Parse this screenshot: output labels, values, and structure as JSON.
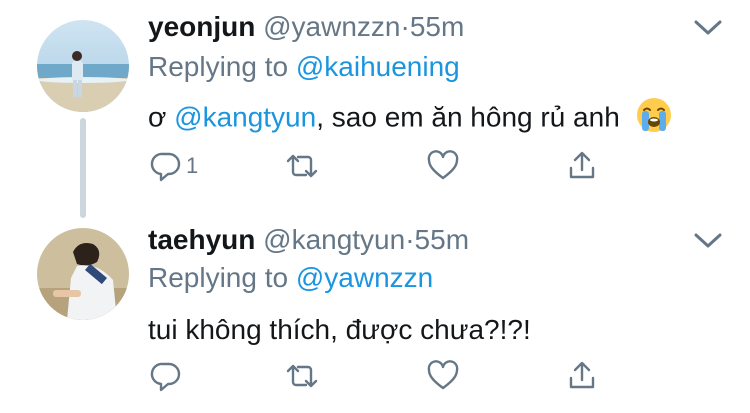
{
  "colors": {
    "name": "#14171a",
    "secondary": "#657786",
    "link": "#1b95e0",
    "thread_line": "#ccd6dd"
  },
  "tweets": [
    {
      "display_name": "yeonjun",
      "handle": "@yawnzzn",
      "separator": "·",
      "time": "55m",
      "replying_prefix": "Replying to ",
      "replying_to": "@kaihuening",
      "body_prefix": "ơ ",
      "body_mention": "@kangtyun",
      "body_rest": ", sao em ăn hông rủ anh",
      "emoji": "loudly-crying-face",
      "reply_count": "1",
      "icons": [
        "reply-icon",
        "retweet-icon",
        "like-icon",
        "share-icon"
      ]
    },
    {
      "display_name": "taehyun",
      "handle": "@kangtyun",
      "separator": "·",
      "time": "55m",
      "replying_prefix": "Replying to ",
      "replying_to": "@yawnzzn",
      "body": "tui không thích, được chưa?!?!",
      "icons": [
        "reply-icon",
        "retweet-icon",
        "like-icon",
        "share-icon"
      ]
    }
  ]
}
